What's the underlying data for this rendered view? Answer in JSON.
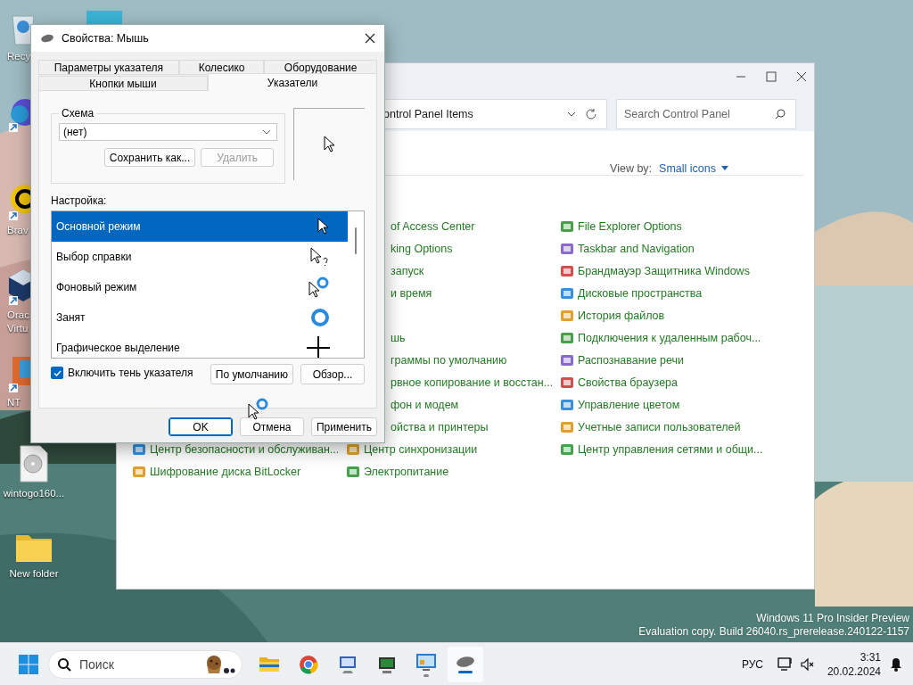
{
  "desktop": {
    "icons": [
      {
        "kind": "recycle",
        "label": "Recy"
      },
      {
        "kind": "screen"
      },
      {
        "kind": "edge"
      },
      {
        "kind": "brave",
        "label": "Brav"
      },
      {
        "kind": "vbox",
        "label": "Orac Virtu"
      },
      {
        "kind": "nt",
        "label": "NT"
      },
      {
        "kind": "disc",
        "label": "wintogo160..."
      },
      {
        "kind": "folder",
        "label": "New folder"
      }
    ],
    "os_notice": [
      "Windows 11 Pro Insider Preview",
      "Evaluation copy. Build 26040.rs_prerelease.240122-1157"
    ]
  },
  "control_panel": {
    "address": "ontrol Panel Items",
    "search": {
      "placeholder": "Search Control Panel"
    },
    "view_by": {
      "label": "View by:",
      "value": "Small icons"
    },
    "rows": [
      {
        "middle": {
          "text": "of Access Center",
          "cut": true
        },
        "right": {
          "text": "File Explorer Options",
          "cut": false
        }
      },
      {
        "middle": {
          "text": "king Options",
          "cut": true
        },
        "right": {
          "text": "Taskbar and Navigation",
          "cut": false
        }
      },
      {
        "middle": {
          "text": "запуск",
          "cut": true
        },
        "right": {
          "text": "Брандмауэр Защитника Windows",
          "cut": false
        }
      },
      {
        "middle": {
          "text": "и время",
          "cut": true
        },
        "right": {
          "text": "Дисковые пространства",
          "cut": false
        }
      },
      {
        "right": {
          "text": "История файлов",
          "cut": false
        }
      },
      {
        "middle": {
          "text": "шь",
          "cut": true
        },
        "right": {
          "text": "Подключения к удаленным рабоч...",
          "cut": false
        }
      },
      {
        "middle": {
          "text": "граммы по умолчанию",
          "cut": true
        },
        "right": {
          "text": "Распознавание речи",
          "cut": false
        }
      },
      {
        "middle": {
          "text": "рвное копирование и восстан...",
          "cut": true
        },
        "right": {
          "text": "Свойства браузера",
          "cut": false
        }
      },
      {
        "middle": {
          "text": "фон и модем",
          "cut": true
        },
        "right": {
          "text": "Управление цветом",
          "cut": false
        }
      },
      {
        "middle": {
          "text": "ойства и принтеры",
          "cut": true
        },
        "right": {
          "text": "Учетные записи пользователей",
          "cut": false
        }
      },
      {
        "left": {
          "text": "Центр безопасности и обслуживан...",
          "cut": false
        },
        "middle": {
          "text": "Центр синхронизации",
          "cut": false
        },
        "right": {
          "text": "Центр управления сетями и общи...",
          "cut": false
        }
      },
      {
        "left": {
          "text": "Шифрование диска BitLocker",
          "cut": false
        },
        "middle": {
          "text": "Электропитание",
          "cut": false
        }
      }
    ]
  },
  "mouse_dialog": {
    "title": "Свойства: Мышь",
    "tabs_back": [
      {
        "label": "Параметры указателя",
        "selected": false
      },
      {
        "label": "Колесико",
        "selected": false
      },
      {
        "label": "Оборудование",
        "selected": false
      }
    ],
    "tabs_front": [
      {
        "label": "Кнопки мыши",
        "selected": false
      },
      {
        "label": "Указатели",
        "selected": true
      }
    ],
    "scheme": {
      "label": "Схема",
      "value": "(нет)",
      "buttons": [
        {
          "label": "Сохранить как...",
          "disabled": false
        },
        {
          "label": "Удалить",
          "disabled": true
        }
      ]
    },
    "customize_label": "Настройка:",
    "pointers": [
      {
        "name": "Основной режим",
        "kind": "arrow",
        "selected": true
      },
      {
        "name": "Выбор справки",
        "kind": "help",
        "selected": false
      },
      {
        "name": "Фоновый режим",
        "kind": "working",
        "selected": false
      },
      {
        "name": "Занят",
        "kind": "busy",
        "selected": false
      },
      {
        "name": "Графическое выделение",
        "kind": "cross",
        "selected": false
      }
    ],
    "shadow": {
      "label": "Включить тень указателя",
      "checked": true
    },
    "list_buttons": [
      "По умолчанию",
      "Обзор..."
    ],
    "footer_buttons": [
      {
        "label": "OK",
        "default": true
      },
      {
        "label": "Отмена",
        "default": false
      },
      {
        "label": "Применить",
        "default": false
      }
    ]
  },
  "taskbar": {
    "search": {
      "placeholder": "Поиск"
    },
    "apps": [
      {
        "kind": "explorer",
        "selected": false
      },
      {
        "kind": "chrome",
        "selected": false
      },
      {
        "kind": "remote",
        "selected": false
      },
      {
        "kind": "terminal",
        "selected": false
      },
      {
        "kind": "control",
        "selected": false
      },
      {
        "kind": "mouse",
        "selected": true
      }
    ],
    "language": "РУС",
    "time": "3:31",
    "date": "20.02.2024"
  }
}
